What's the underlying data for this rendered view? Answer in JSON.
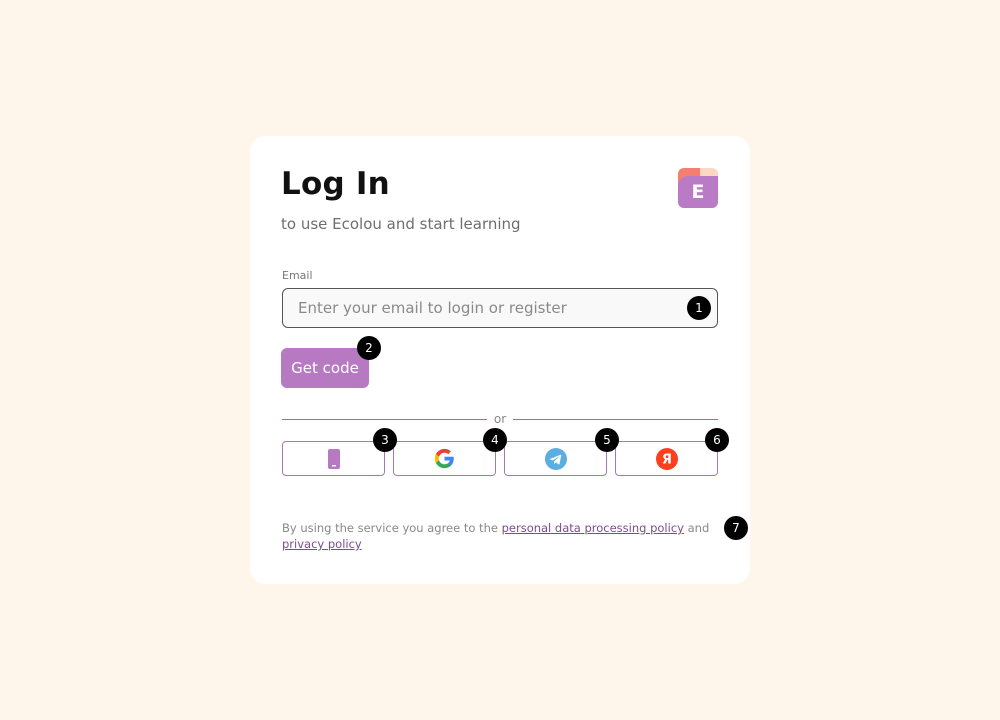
{
  "header": {
    "title": "Log In",
    "subtitle": "to use Ecolou and start learning"
  },
  "logo": {
    "letter": "E",
    "colors": {
      "front": "#b97bc6",
      "leaf": "#f47f71",
      "back": "#fcd7c2"
    }
  },
  "form": {
    "email_label": "Email",
    "email_placeholder": "Enter your email to login or register",
    "email_value": "",
    "get_code_label": "Get code"
  },
  "divider": {
    "text": "or"
  },
  "social": [
    {
      "icon": "phone-icon"
    },
    {
      "icon": "google-icon"
    },
    {
      "icon": "telegram-icon"
    },
    {
      "icon": "yandex-icon"
    }
  ],
  "consent": {
    "prefix": "By using the service you agree to the ",
    "link1": "personal data processing policy",
    "middle": " and ",
    "link2": "privacy policy"
  },
  "badges": [
    "1",
    "2",
    "3",
    "4",
    "5",
    "6",
    "7"
  ],
  "colors": {
    "accent": "#b77ac2",
    "link": "#7e4a92",
    "page_background": "#fff6eb",
    "badge": "#000000"
  }
}
